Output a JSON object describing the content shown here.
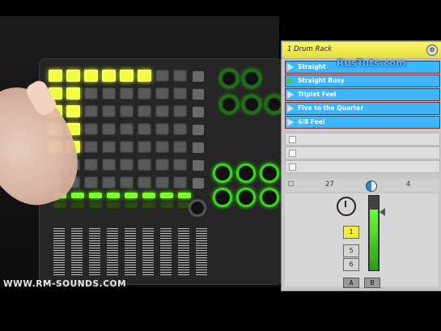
{
  "watermark": "WWW.RM-SOUNDS.COM",
  "overlay_watermark": "RusTuts.com",
  "drum_rack": {
    "title": "1 Drum Rack",
    "chains": [
      {
        "label": "Straight",
        "active": false
      },
      {
        "label": "Straight Busy",
        "active": true
      },
      {
        "label": "Triplet Feel",
        "active": false
      },
      {
        "label": "Five to the Quarter",
        "active": false
      },
      {
        "label": "6/8 Feel",
        "active": false
      }
    ],
    "empty_slots": 3,
    "controls": {
      "left_value": "27",
      "right_value": "4"
    },
    "keys": [
      "1",
      "5",
      "6"
    ],
    "buttons": [
      "A",
      "B"
    ]
  },
  "colors": {
    "accent": "#3db6ff",
    "header": "#f0e84b",
    "pad_lit": "#f2ff3a",
    "led_green": "#7dff2a"
  },
  "icons": {
    "gear": "gear-icon",
    "timer": "stopwatch-icon",
    "play": "play-icon",
    "pan": "pan-knob-icon"
  }
}
